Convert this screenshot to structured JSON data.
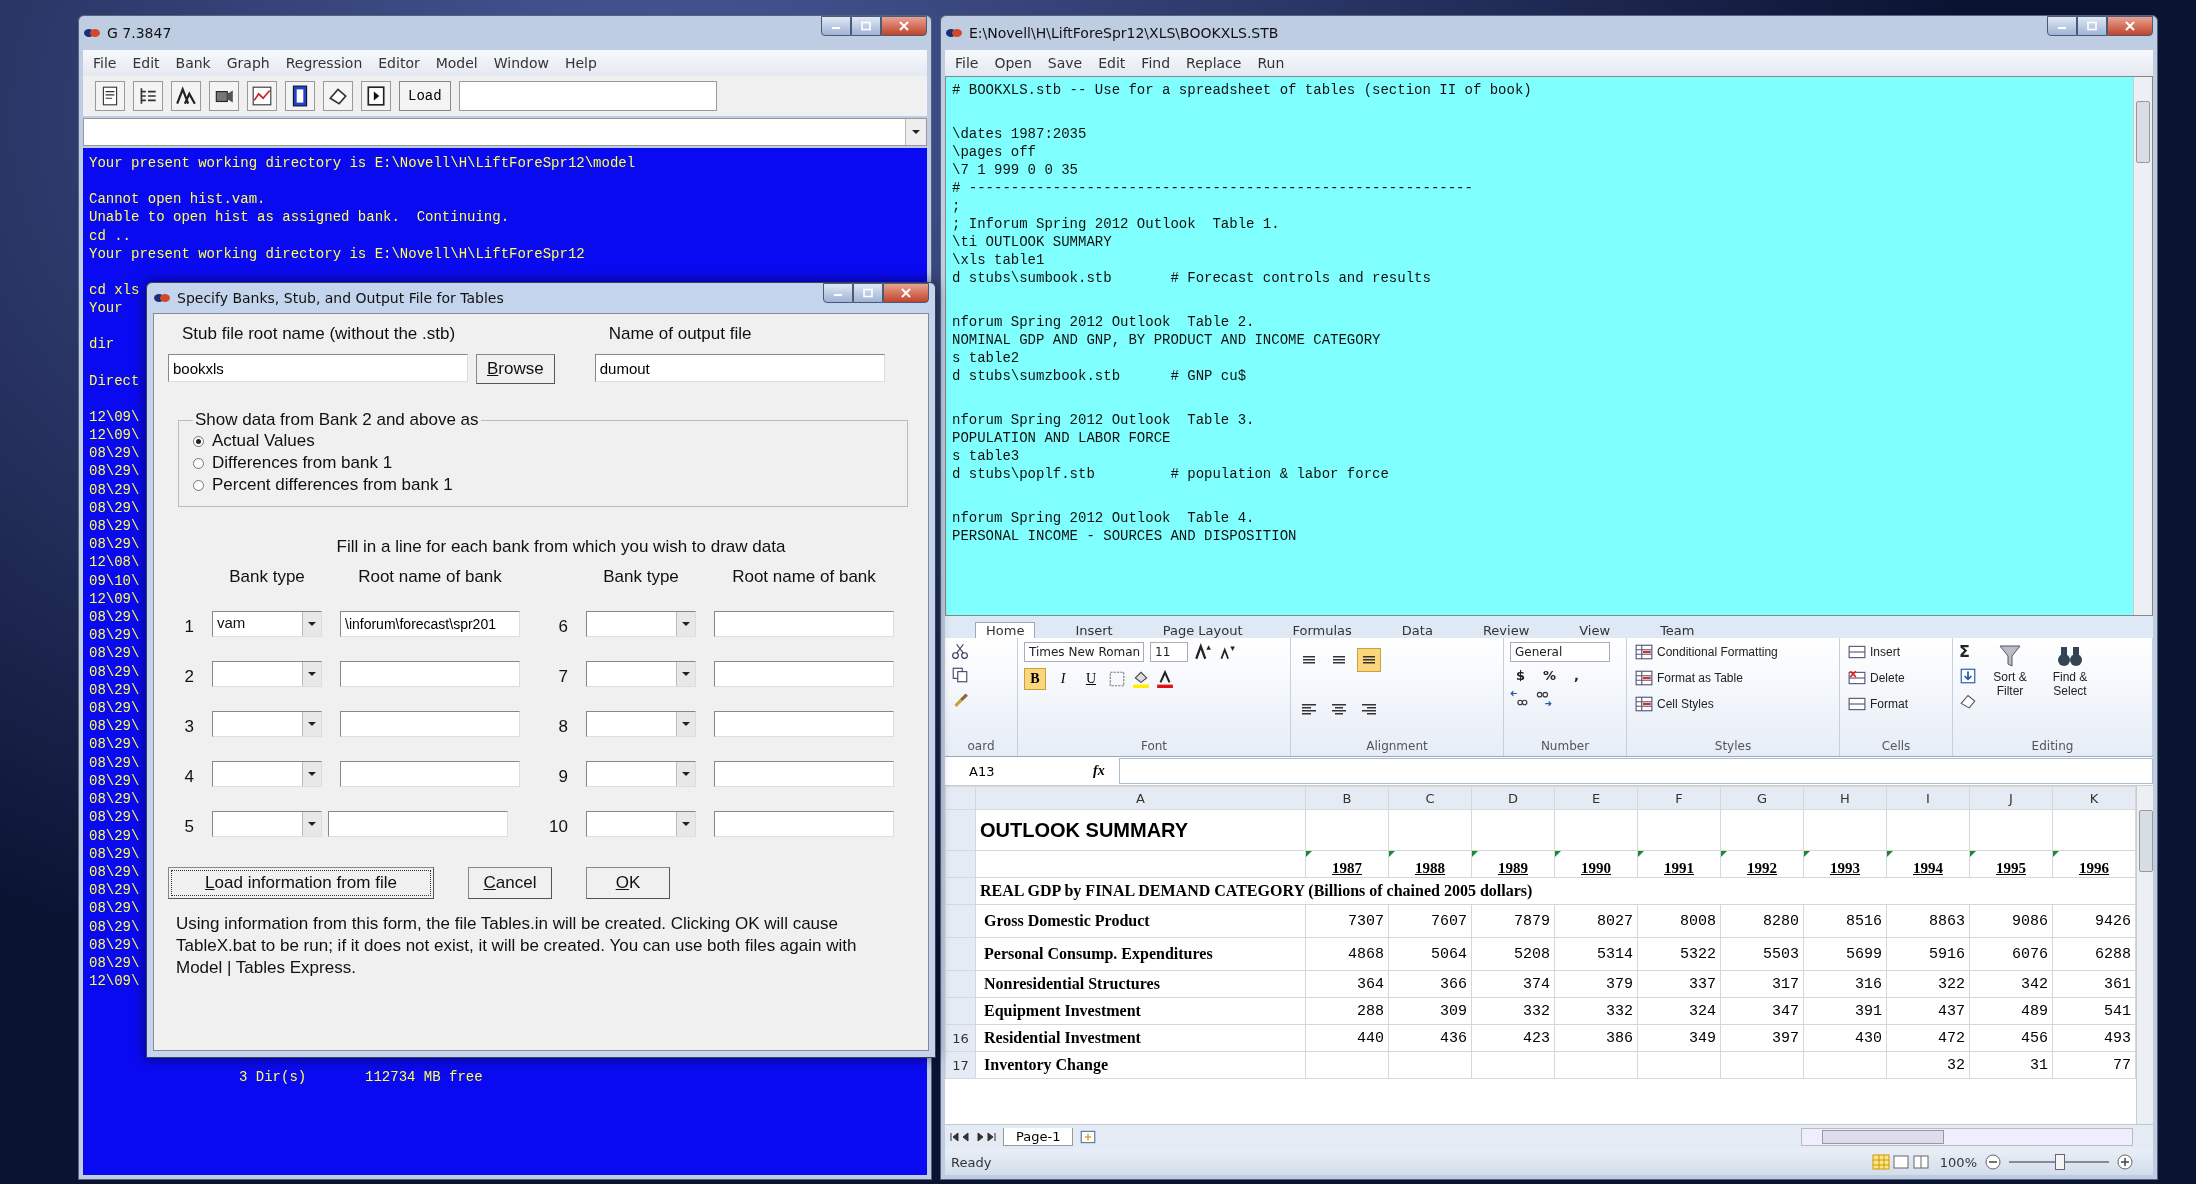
{
  "left_window": {
    "title": "G 7.3847",
    "menu": [
      "File",
      "Edit",
      "Bank",
      "Graph",
      "Regression",
      "Editor",
      "Model",
      "Window",
      "Help"
    ],
    "toolbar": {
      "load_button": "Load"
    },
    "console": {
      "blocks": [
        [
          "Your present working directory is E:\\Novell\\H\\LiftForeSpr12\\model"
        ],
        [
          "Cannot open hist.vam.",
          "Unable to open hist as assigned bank.  Continuing.",
          "cd ..",
          "Your present working directory is E:\\Novell\\H\\LiftForeSpr12"
        ],
        [
          "cd xls",
          "Your"
        ],
        [
          "dir"
        ],
        [
          "Direct"
        ],
        [
          "12\\09\\",
          "12\\09\\",
          "08\\29\\",
          "08\\29\\",
          "08\\29\\",
          "08\\29\\",
          "08\\29\\",
          "08\\29\\",
          "12\\08\\",
          "09\\10\\",
          "12\\09\\",
          "08\\29\\",
          "08\\29\\",
          "08\\29\\",
          "08\\29\\",
          "08\\29\\",
          "08\\29\\",
          "08\\29\\",
          "08\\29\\",
          "08\\29\\",
          "08\\29\\",
          "08\\29\\",
          "08\\29\\",
          "08\\29\\",
          "08\\29\\",
          "08\\29\\",
          "08\\29\\",
          "08\\29\\",
          "08\\29\\",
          "08\\29\\",
          "08\\29\\",
          "12\\09\\"
        ]
      ],
      "footer": "3 Dir(s)       112734 MB free"
    }
  },
  "dialog": {
    "title": "Specify Banks, Stub, and Output File for Tables",
    "stub_label": "Stub file root name (without the .stb)",
    "stub_value": "bookxls",
    "browse_button": "Browse",
    "output_label": "Name of output file",
    "output_value": "dumout",
    "show_group": {
      "legend": "Show data from Bank 2 and above as",
      "options": [
        {
          "label": "Actual Values",
          "selected": true
        },
        {
          "label": "Differences from bank 1",
          "selected": false
        },
        {
          "label": "Percent differences from bank 1",
          "selected": false
        }
      ]
    },
    "fill_instruction": "Fill in a line for each bank from which you wish to draw data",
    "column_headers": [
      "Bank type",
      "Root name of bank",
      "Bank type",
      "Root name of bank"
    ],
    "banks": [
      {
        "number": "1",
        "type": "vam",
        "root": "\\inforum\\forecast\\spr201"
      },
      {
        "number": "2"
      },
      {
        "number": "3"
      },
      {
        "number": "4"
      },
      {
        "number": "5"
      },
      {
        "number": "6"
      },
      {
        "number": "7"
      },
      {
        "number": "8"
      },
      {
        "number": "9"
      },
      {
        "number": "10"
      }
    ],
    "buttons": [
      {
        "label": "Load information from file",
        "kind": "load"
      },
      {
        "label": "Cancel",
        "kind": "cancel"
      },
      {
        "label": "OK",
        "kind": "ok"
      }
    ],
    "note": "Using information from this form, the file Tables.in will be created.  Clicking OK will cause TableX.bat to be run; if it does not exist, it will be created.    You can use both files again with Model | Tables Express."
  },
  "editor_window": {
    "title": "E:\\Novell\\H\\LiftForeSpr12\\XLS\\BOOKXLS.STB",
    "menu": [
      "File",
      "Open",
      "Save",
      "Edit",
      "Find",
      "Replace",
      "Run"
    ],
    "blocks": [
      [
        "# BOOKXLS.stb -- Use for a spreadsheet of tables (section II of book)"
      ],
      [
        "\\dates 1987:2035",
        "\\pages off",
        "\\7 1 999 0 0 35",
        "# ------------------------------------------------------------",
        ";",
        "; Inforum Spring 2012 Outlook  Table 1.",
        "\\ti OUTLOOK SUMMARY",
        "\\xls table1",
        "d stubs\\sumbook.stb       # Forecast controls and results"
      ],
      [
        "nforum Spring 2012 Outlook  Table 2.",
        "NOMINAL GDP AND GNP, BY PRODUCT AND INCOME CATEGORY",
        "s table2",
        "d stubs\\sumzbook.stb      # GNP cu$"
      ],
      [
        "nforum Spring 2012 Outlook  Table 3.",
        "POPULATION AND LABOR FORCE",
        "s table3",
        "d stubs\\poplf.stb         # population & labor force"
      ],
      [
        "nforum Spring 2012 Outlook  Table 4.",
        "PERSONAL INCOME - SOURCES AND DISPOSITION"
      ]
    ]
  },
  "spreadsheet": {
    "tabs": [
      {
        "label": "Home",
        "selected": true
      },
      {
        "label": "Insert",
        "selected": false
      },
      {
        "label": "Page Layout",
        "selected": false
      },
      {
        "label": "Formulas",
        "selected": false
      },
      {
        "label": "Data",
        "selected": false
      },
      {
        "label": "Review",
        "selected": false
      },
      {
        "label": "View",
        "selected": false
      },
      {
        "label": "Team",
        "selected": false
      }
    ],
    "ribbon": {
      "clipboard_label": "oard",
      "font_name": "Times New Roman",
      "font_size": "11",
      "format_buttons": [
        {
          "label": "B",
          "selected": true
        },
        {
          "label": "I",
          "selected": false
        },
        {
          "label": "U",
          "selected": false
        }
      ],
      "font_label": "Font",
      "alignment": [
        {
          "kind": "top",
          "selected": false
        },
        {
          "kind": "middle",
          "selected": false
        },
        {
          "kind": "bottom",
          "selected": true
        },
        {
          "kind": "left",
          "selected": false
        },
        {
          "kind": "center",
          "selected": false
        },
        {
          "kind": "right",
          "selected": false
        }
      ],
      "alignment_label": "Alignment",
      "number_format": "General",
      "number_symbols": [
        "$",
        "%",
        ","
      ],
      "number_label": "Number",
      "styles": [
        "Conditional Formatting",
        "Format as Table",
        "Cell Styles"
      ],
      "styles_label": "Styles",
      "cells": [
        "Insert",
        "Delete",
        "Format"
      ],
      "cells_label": "Cells",
      "sum_symbol": "Σ",
      "editing": [
        "Sort & Filter",
        "Find & Select"
      ],
      "editing_label": "Editing"
    },
    "name_box": "A13",
    "formula_label": "fx",
    "columns": [
      "A",
      "B",
      "C",
      "D",
      "E",
      "F",
      "G",
      "H",
      "I",
      "J",
      "K"
    ],
    "rows": [
      {
        "kind": "title",
        "label": "OUTLOOK SUMMARY"
      },
      {
        "kind": "years",
        "values": [
          "1987",
          "1988",
          "1989",
          "1990",
          "1991",
          "1992",
          "1993",
          "1994",
          "1995",
          "1996"
        ]
      },
      {
        "kind": "section",
        "label": "REAL GDP by FINAL DEMAND CATEGORY (Billions of chained 2005 dollars)"
      },
      {
        "kind": "data",
        "label": "Gross Domestic Product",
        "values": [
          "7307",
          "7607",
          "7879",
          "8027",
          "8008",
          "8280",
          "8516",
          "8863",
          "9086",
          "9426"
        ]
      },
      {
        "kind": "data",
        "label": "Personal Consump. Expenditures",
        "values": [
          "4868",
          "5064",
          "5208",
          "5314",
          "5322",
          "5503",
          "5699",
          "5916",
          "6076",
          "6288"
        ]
      },
      {
        "kind": "data",
        "label": "Nonresidential Structures",
        "values": [
          "364",
          "366",
          "374",
          "379",
          "337",
          "317",
          "316",
          "322",
          "342",
          "361"
        ]
      },
      {
        "kind": "data",
        "label": "Equipment Investment",
        "values": [
          "288",
          "309",
          "332",
          "332",
          "324",
          "347",
          "391",
          "437",
          "489",
          "541"
        ]
      },
      {
        "kind": "data",
        "number": "16",
        "label": "Residential Investment",
        "values": [
          "440",
          "436",
          "423",
          "386",
          "349",
          "397",
          "430",
          "472",
          "456",
          "493"
        ]
      },
      {
        "kind": "data",
        "number": "17",
        "label": "Inventory Change",
        "values": [
          "32",
          "31",
          "77"
        ]
      }
    ],
    "sheet_tab": "Page-1",
    "status": "Ready",
    "zoom": "100%",
    "zoom_slider": {
      "level": 0.5
    }
  }
}
